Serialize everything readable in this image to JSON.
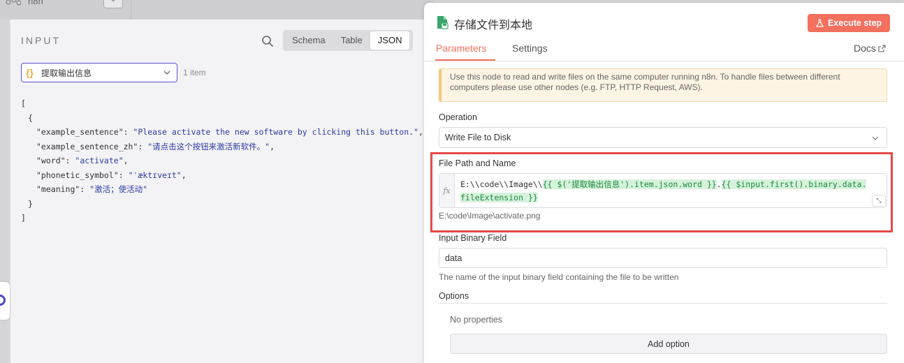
{
  "background": {
    "node_label": "n8n",
    "plus": "+"
  },
  "input_panel": {
    "title": "INPUT",
    "view_tabs": [
      "Schema",
      "Table",
      "JSON"
    ],
    "active_view": "JSON",
    "node_select": {
      "icon": "{}",
      "value": "提取输出信息"
    },
    "item_count": "1 item",
    "json": {
      "open_bracket": "[",
      "open_brace": "{",
      "close_brace": "}",
      "close_bracket": "]",
      "fields": [
        {
          "key": "\"example_sentence\": ",
          "value": "\"Please activate the new software by clicking this button.\"",
          "sep": ","
        },
        {
          "key": "\"example_sentence_zh\": ",
          "value": "\"请点击这个按钮来激活新软件。\"",
          "sep": ","
        },
        {
          "key": "\"word\": ",
          "value": "\"activate\"",
          "sep": ","
        },
        {
          "key": "\"phonetic_symbol\": ",
          "value": "\"ˈæktɪveɪt\"",
          "sep": ","
        },
        {
          "key": "\"meaning\": ",
          "value": "\"激活；使活动\"",
          "sep": ""
        }
      ]
    }
  },
  "node_panel": {
    "title": "存储文件到本地",
    "execute_label": "Execute step",
    "execute_icon": "flask-icon",
    "tabs": [
      "Parameters",
      "Settings"
    ],
    "active_tab": "Parameters",
    "docs_label": "Docs",
    "notice": "Use this node to read and write files on the same computer running n8n. To handle files between different computers please use other nodes (e.g. FTP, HTTP Request, AWS).",
    "operation": {
      "label": "Operation",
      "value": "Write File to Disk"
    },
    "file_path": {
      "label": "File Path and Name",
      "fx": "fx",
      "parts": [
        {
          "text": "E:\\\\code\\\\Image\\\\",
          "type": "plain"
        },
        {
          "text": "{{ $('提取输出信息').item.json.word }}",
          "type": "expr"
        },
        {
          "text": ".",
          "type": "plain"
        },
        {
          "text": "{{ $input.first().binary.data.",
          "type": "expr"
        }
      ],
      "line2": "fileExtension }}",
      "preview": "E:\\code\\Image\\activate.png"
    },
    "binary_field": {
      "label": "Input Binary Field",
      "value": "data",
      "hint": "The name of the input binary field containing the file to be written"
    },
    "options": {
      "label": "Options",
      "empty": "No properties",
      "add_label": "Add option"
    },
    "colors": {
      "accent": "#f36f5e",
      "highlight_border": "#e64848",
      "expr_bg": "#d6f2dd"
    }
  }
}
